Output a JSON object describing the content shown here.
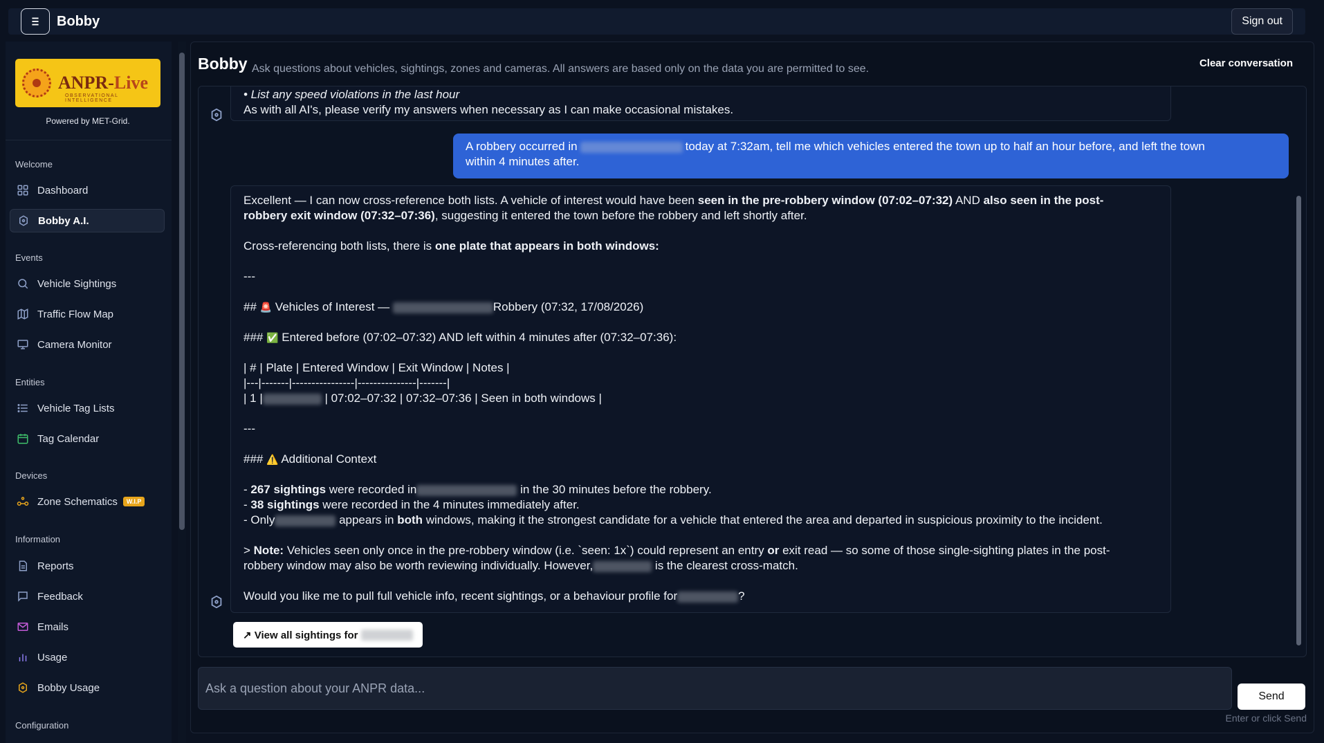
{
  "topbar": {
    "title": "Bobby",
    "signout_label": "Sign out"
  },
  "sidebar": {
    "logo_text_a": "ANPR-",
    "logo_text_b": "Live",
    "logo_sub": "OBSERVATIONAL INTELLIGENCE",
    "powered_by": "Powered by MET-Grid.",
    "sections": {
      "welcome": "Welcome",
      "events": "Events",
      "entities": "Entities",
      "devices": "Devices",
      "information": "Information",
      "configuration": "Configuration"
    },
    "items": {
      "dashboard": "Dashboard",
      "bobby_ai": "Bobby A.I.",
      "vehicle_sightings": "Vehicle Sightings",
      "traffic_flow_map": "Traffic Flow Map",
      "camera_monitor": "Camera Monitor",
      "vehicle_tag_lists": "Vehicle Tag Lists",
      "tag_calendar": "Tag Calendar",
      "zone_schematics": "Zone Schematics",
      "zone_badge": "W.I.P",
      "reports": "Reports",
      "feedback": "Feedback",
      "emails": "Emails",
      "usage": "Usage",
      "bobby_usage": "Bobby Usage"
    }
  },
  "main": {
    "title": "Bobby",
    "subtitle": "Ask questions about vehicles, sightings, zones and cameras. All answers are based only on the data you are permitted to see.",
    "clear_label": "Clear conversation"
  },
  "chat": {
    "intro": {
      "line1": "• List any speed violations in the last hour",
      "line2": "As with all AI's, please verify my answers when necessary as I can make occasional mistakes."
    },
    "user_message": {
      "part1": "A robbery occurred in",
      "part2": "today at 7:32am, tell me which vehicles entered the town up to half an hour before, and left the town",
      "part3": "within 4 minutes after."
    },
    "reply": {
      "p1a": "Excellent — I can now cross-reference both lists. A vehicle of interest would have been ",
      "p1b": "seen in the pre-robbery window (07:02–07:32)",
      "p1c": " AND ",
      "p1d": "also seen in the post-",
      "p2a": "robbery exit window (07:32–07:36)",
      "p2b": ", suggesting it entered the town before the robbery and left shortly after.",
      "p3a": "Cross-referencing both lists, there is ",
      "p3b": "one plate that appears in both windows:",
      "hr1": "---",
      "h2_prefix": "## ",
      "h2_icon": "🚨",
      "h2a": " Vehicles of Interest — ",
      "h2b": "Robbery (07:32, 17/08/2026)",
      "h3_prefix": "### ",
      "h3_icon": "✅",
      "h3_text": " Entered before (07:02–07:32) AND left within 4 minutes after (07:32–07:36):",
      "t1": "| # | Plate | Entered Window | Exit Window | Notes |",
      "t2": "|---|-------|----------------|---------------|-------|",
      "t3a": "| 1 |",
      "t3b": " | 07:02–07:32 | 07:32–07:36 | Seen in both windows |",
      "hr2": "---",
      "h3b_prefix": "### ",
      "h3b_icon": "⚠️",
      "h3b_text": " Additional Context",
      "b1a": "- ",
      "b1b": "267 sightings",
      "b1c": " were recorded in",
      "b1d": " in the 30 minutes before the robbery.",
      "b2a": "- ",
      "b2b": "38 sightings",
      "b2c": " were recorded in the 4 minutes immediately after.",
      "b3a": "- Only",
      "b3b": " appears in ",
      "b3c": "both",
      "b3d": " windows, making it the strongest candidate for a vehicle that entered the area and departed in suspicious proximity to the incident.",
      "n1a": "> ",
      "n1b": "Note:",
      "n1c": " Vehicles seen only once in the pre-robbery window (i.e. `seen: 1x`) could represent an entry ",
      "n1d": "or",
      "n1e": " exit read — so some of those single-sighting plates in the post-",
      "n2a": "robbery window may also be worth reviewing individually. However,",
      "n2b": " is the clearest cross-match.",
      "q1": "Would you like me to pull full vehicle info, recent sightings, or a behaviour profile for",
      "q2": "?"
    },
    "view_button": "↗ View all sightings for"
  },
  "composer": {
    "placeholder": "Ask a question about your ANPR data...",
    "send_label": "Send",
    "hint": "Enter or click Send"
  },
  "colors": {
    "user_bubble": "#2e63d6",
    "background": "#0b1220",
    "wip_badge": "#e7a51c"
  }
}
